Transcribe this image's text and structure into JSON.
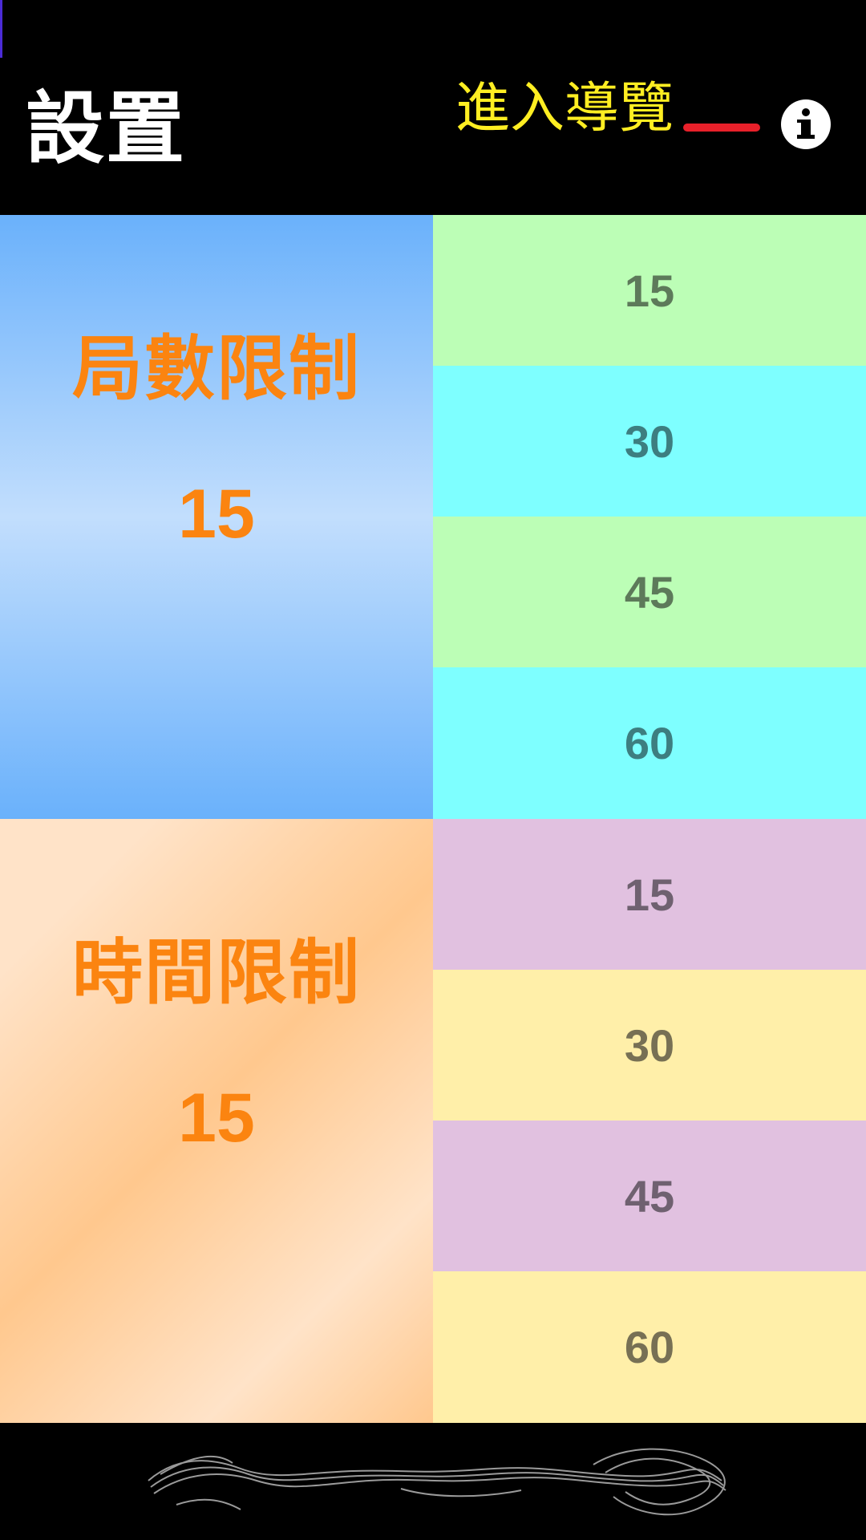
{
  "header": {
    "title": "設置",
    "tour_link": "進入導覽",
    "info_icon": "info-icon",
    "tour_line_color": "#e8202a",
    "tour_link_color": "#ffee22"
  },
  "rounds_limit": {
    "label": "局數限制",
    "current_value": "15",
    "options": [
      "15",
      "30",
      "45",
      "60"
    ],
    "colors": {
      "panel": "#6ab1fb",
      "option_a": "#bcfeb6",
      "option_b": "#7effff"
    }
  },
  "time_limit": {
    "label": "時間限制",
    "current_value": "15",
    "options": [
      "15",
      "30",
      "45",
      "60"
    ],
    "colors": {
      "panel": "#ffc88e",
      "option_a": "#e1c1e0",
      "option_b": "#ffefa9"
    }
  },
  "accent_color": "#fb8410"
}
